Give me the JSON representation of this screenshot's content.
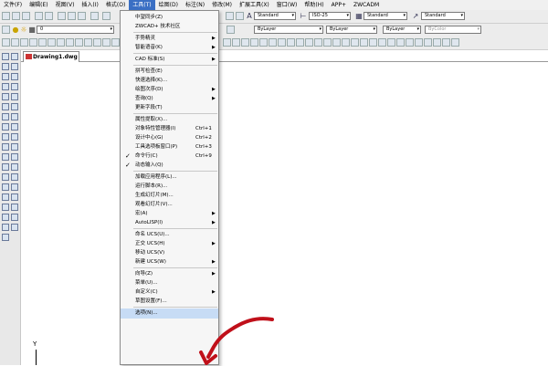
{
  "menubar": {
    "items": [
      {
        "label": "文件(F)"
      },
      {
        "label": "编辑(E)"
      },
      {
        "label": "视图(V)"
      },
      {
        "label": "插入(I)"
      },
      {
        "label": "格式(O)"
      },
      {
        "label": "工具(T)",
        "active": true
      },
      {
        "label": "绘图(D)"
      },
      {
        "label": "标注(N)"
      },
      {
        "label": "修改(M)"
      },
      {
        "label": "扩展工具(X)"
      },
      {
        "label": "窗口(W)"
      },
      {
        "label": "帮助(H)"
      },
      {
        "label": "APP+"
      },
      {
        "label": "ZWCADM"
      }
    ]
  },
  "toolbar": {
    "text_style": "Standard",
    "dim_style": "ISO-25",
    "table_style": "Standard",
    "multileader_style": "Standard",
    "layer": "0",
    "linetype": "ByLayer",
    "lineweight": "ByLayer",
    "color": "ByLayer",
    "plot_style": "ByColor"
  },
  "document": {
    "tab_label": "Drawing1.dwg",
    "ucs_y_label": "Y"
  },
  "tools_menu": [
    {
      "label": "中望同步(Z)"
    },
    {
      "label": "ZWCAD+ 技术社区"
    },
    {
      "sep": true
    },
    {
      "label": "手势精灵",
      "arrow": true
    },
    {
      "label": "智能语音(K)",
      "arrow": true
    },
    {
      "sep": true
    },
    {
      "label": "CAD 标准(S)",
      "arrow": true
    },
    {
      "sep": true
    },
    {
      "label": "拼写检查(E)"
    },
    {
      "label": "快速选择(K)..."
    },
    {
      "label": "绘图次序(D)",
      "arrow": true
    },
    {
      "label": "查询(Q)",
      "arrow": true
    },
    {
      "label": "更新字段(T)"
    },
    {
      "sep": true
    },
    {
      "label": "属性提取(X)..."
    },
    {
      "label": "对象特性管理器(I)",
      "shortcut": "Ctrl+1"
    },
    {
      "label": "设计中心(G)",
      "shortcut": "Ctrl+2"
    },
    {
      "label": "工具选项板窗口(P)",
      "shortcut": "Ctrl+3"
    },
    {
      "label": "命令行(C)",
      "shortcut": "Ctrl+9",
      "checked": true
    },
    {
      "label": "动态输入(Q)",
      "checked": true
    },
    {
      "sep": true
    },
    {
      "label": "加载应用程序(L)..."
    },
    {
      "label": "运行脚本(R)..."
    },
    {
      "label": "生成幻灯片(M)..."
    },
    {
      "label": "观看幻灯片(V)..."
    },
    {
      "label": "宏(A)",
      "arrow": true
    },
    {
      "label": "AutoLISP(I)",
      "arrow": true
    },
    {
      "sep": true
    },
    {
      "label": "命名 UCS(U)..."
    },
    {
      "label": "正交 UCS(H)",
      "arrow": true
    },
    {
      "label": "移动 UCS(V)"
    },
    {
      "label": "新建 UCS(W)",
      "arrow": true
    },
    {
      "sep": true
    },
    {
      "label": "向导(Z)",
      "arrow": true
    },
    {
      "label": "菜单(U)..."
    },
    {
      "label": "自定义(C)",
      "arrow": true
    },
    {
      "label": "草图设置(F)..."
    },
    {
      "sep": true
    },
    {
      "label": "选项(N)...",
      "highlighted": true
    }
  ],
  "colors": {
    "active_menu_bg": "#3a6fc4",
    "annotation_arrow": "#c0101a",
    "highlight": "#c7dcf5"
  }
}
